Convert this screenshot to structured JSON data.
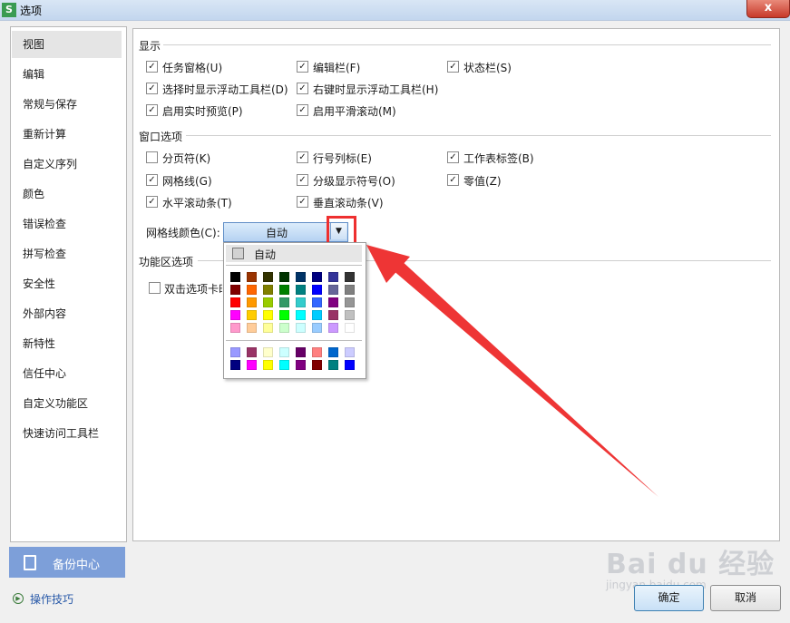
{
  "window": {
    "title": "选项",
    "app_icon": "S",
    "close_label": "x"
  },
  "sidebar": {
    "items": [
      {
        "label": "视图",
        "active": true
      },
      {
        "label": "编辑"
      },
      {
        "label": "常规与保存"
      },
      {
        "label": "重新计算"
      },
      {
        "label": "自定义序列"
      },
      {
        "label": "颜色"
      },
      {
        "label": "错误检查"
      },
      {
        "label": "拼写检查"
      },
      {
        "label": "安全性"
      },
      {
        "label": "外部内容"
      },
      {
        "label": "新特性"
      },
      {
        "label": "信任中心"
      },
      {
        "label": "自定义功能区"
      },
      {
        "label": "快速访问工具栏"
      }
    ],
    "backup_label": "备份中心",
    "tips_label": "操作技巧"
  },
  "display": {
    "title": "显示",
    "checkboxes": [
      {
        "label": "任务窗格(U)",
        "checked": true
      },
      {
        "label": "编辑栏(F)",
        "checked": true
      },
      {
        "label": "状态栏(S)",
        "checked": true
      },
      {
        "label": "选择时显示浮动工具栏(D)",
        "checked": true
      },
      {
        "label": "右键时显示浮动工具栏(H)",
        "checked": true
      },
      {
        "label": "启用实时预览(P)",
        "checked": true
      },
      {
        "label": "启用平滑滚动(M)",
        "checked": true
      }
    ]
  },
  "window_options": {
    "title": "窗口选项",
    "checkboxes": [
      {
        "label": "分页符(K)",
        "checked": false
      },
      {
        "label": "行号列标(E)",
        "checked": true
      },
      {
        "label": "工作表标签(B)",
        "checked": true
      },
      {
        "label": "网格线(G)",
        "checked": true
      },
      {
        "label": "分级显示符号(O)",
        "checked": true
      },
      {
        "label": "零值(Z)",
        "checked": true
      },
      {
        "label": "水平滚动条(T)",
        "checked": true
      },
      {
        "label": "垂直滚动条(V)",
        "checked": true
      }
    ],
    "grid_color_label": "网格线颜色(C):",
    "grid_color_value": "自动"
  },
  "ribbon": {
    "title": "功能区选项",
    "checkbox_label": "双击选项卡时",
    "checked": false
  },
  "palette": {
    "auto_label": "自动",
    "main_rows": [
      [
        "#000000",
        "#993300",
        "#333300",
        "#003300",
        "#003366",
        "#000080",
        "#333399",
        "#333333"
      ],
      [
        "#800000",
        "#ff6600",
        "#808000",
        "#008000",
        "#008080",
        "#0000ff",
        "#666699",
        "#808080"
      ],
      [
        "#ff0000",
        "#ff9900",
        "#99cc00",
        "#339966",
        "#33cccc",
        "#3366ff",
        "#800080",
        "#969696"
      ],
      [
        "#ff00ff",
        "#ffcc00",
        "#ffff00",
        "#00ff00",
        "#00ffff",
        "#00ccff",
        "#993366",
        "#c0c0c0"
      ],
      [
        "#ff99cc",
        "#ffcc99",
        "#ffff99",
        "#ccffcc",
        "#ccffff",
        "#99ccff",
        "#cc99ff",
        "#ffffff"
      ]
    ],
    "extra_rows": [
      [
        "#9999ff",
        "#993366",
        "#ffffcc",
        "#ccffff",
        "#660066",
        "#ff8080",
        "#0066cc",
        "#ccccff"
      ],
      [
        "#000080",
        "#ff00ff",
        "#ffff00",
        "#00ffff",
        "#800080",
        "#800000",
        "#008080",
        "#0000ff"
      ]
    ]
  },
  "buttons": {
    "ok_label": "确定",
    "cancel_label": "取消"
  },
  "watermark": {
    "brand": "Bai du 经验",
    "url": "jingyan.baidu.com"
  },
  "colors": {
    "accent": "#7d9fd9",
    "annotation": "#ee2f2f"
  }
}
